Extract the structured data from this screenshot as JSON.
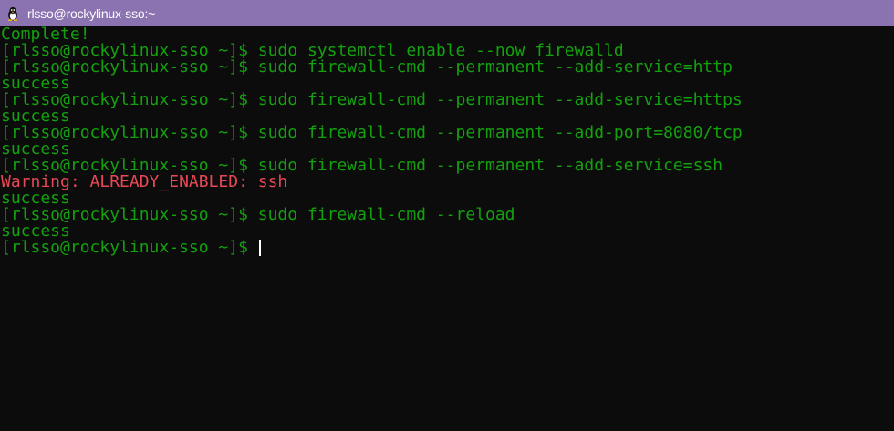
{
  "window": {
    "title": "rlsso@rockylinux-sso:~",
    "icon": "tux-penguin-icon"
  },
  "colors": {
    "titlebar": "#8a73b0",
    "terminal_bg": "#0c0c0c",
    "output_green": "#13a10e",
    "warning_red": "#e74856"
  },
  "terminal": {
    "lines": [
      {
        "text": "Complete!",
        "type": "output"
      },
      {
        "text": "[rlsso@rockylinux-sso ~]$ sudo systemctl enable --now firewalld",
        "type": "command"
      },
      {
        "text": "[rlsso@rockylinux-sso ~]$ sudo firewall-cmd --permanent --add-service=http",
        "type": "command"
      },
      {
        "text": "success",
        "type": "output"
      },
      {
        "text": "[rlsso@rockylinux-sso ~]$ sudo firewall-cmd --permanent --add-service=https",
        "type": "command"
      },
      {
        "text": "success",
        "type": "output"
      },
      {
        "text": "[rlsso@rockylinux-sso ~]$ sudo firewall-cmd --permanent --add-port=8080/tcp",
        "type": "command"
      },
      {
        "text": "success",
        "type": "output"
      },
      {
        "text": "[rlsso@rockylinux-sso ~]$ sudo firewall-cmd --permanent --add-service=ssh",
        "type": "command"
      },
      {
        "text": "Warning: ALREADY_ENABLED: ssh",
        "type": "warning"
      },
      {
        "text": "success",
        "type": "output"
      },
      {
        "text": "[rlsso@rockylinux-sso ~]$ sudo firewall-cmd --reload",
        "type": "command"
      },
      {
        "text": "success",
        "type": "output"
      }
    ],
    "prompt": "[rlsso@rockylinux-sso ~]$ "
  }
}
